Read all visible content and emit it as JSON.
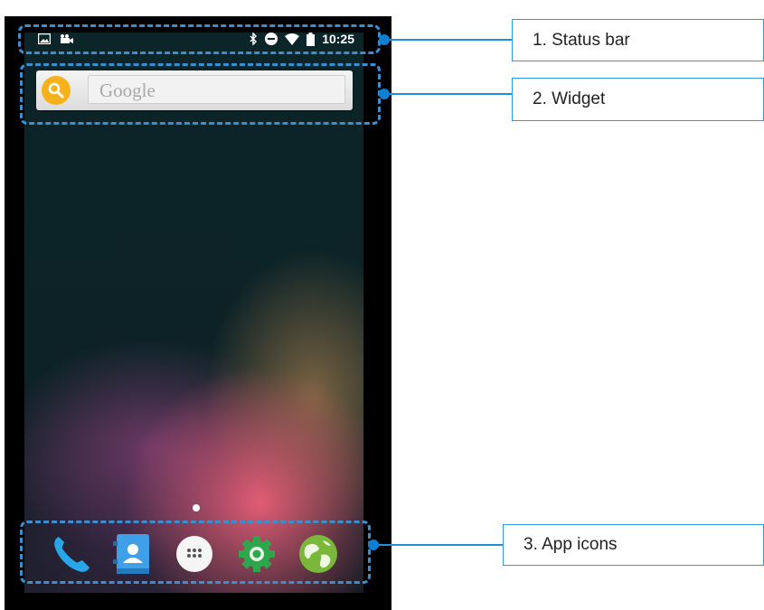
{
  "status_bar": {
    "time": "10:25"
  },
  "widget": {
    "search_placeholder": "Google"
  },
  "callouts": [
    {
      "label": "1. Status bar"
    },
    {
      "label": "2. Widget"
    },
    {
      "label": "3. App icons"
    }
  ],
  "dock_apps": [
    "phone-icon",
    "contacts-icon",
    "app-drawer-icon",
    "settings-icon",
    "browser-icon"
  ],
  "colors": {
    "accent": "#1f8fd8",
    "dash": "#3b8fd0",
    "search_circle": "#f6b21a"
  }
}
